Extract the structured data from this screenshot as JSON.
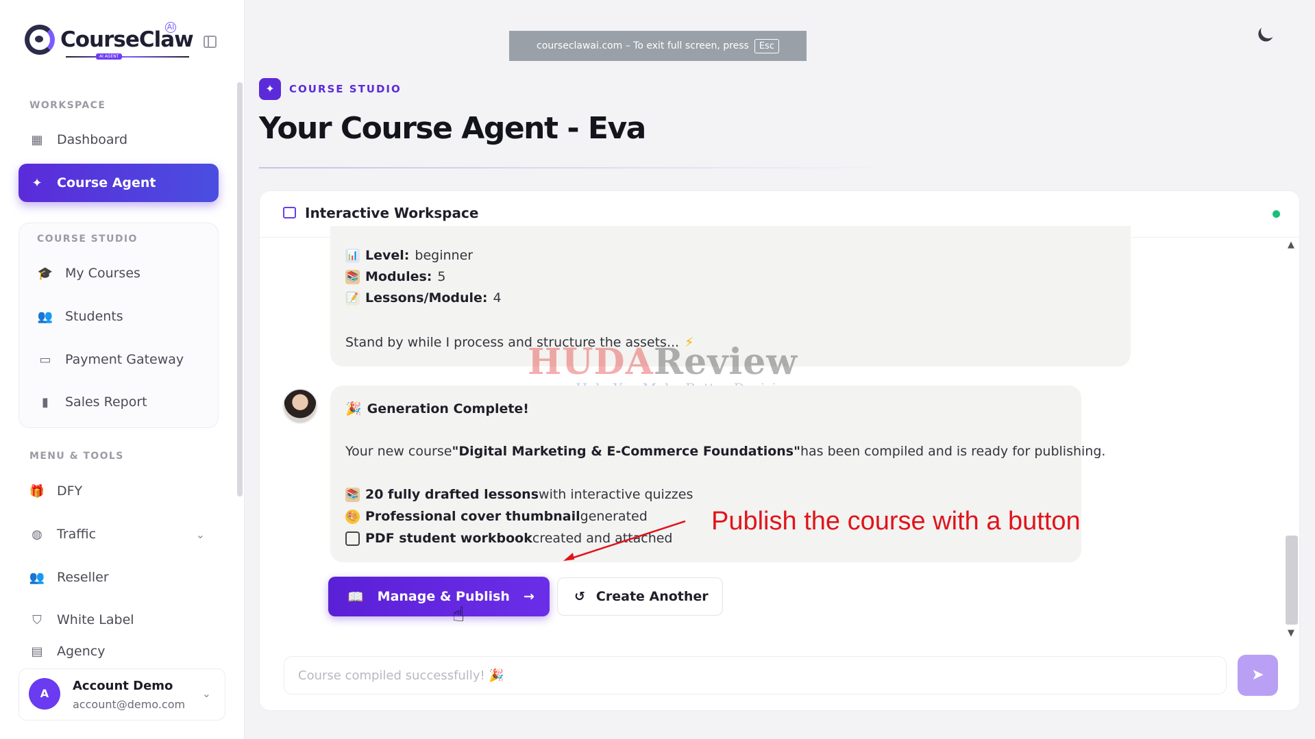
{
  "brand": {
    "name": "CourseClaw",
    "ai_badge": "AI",
    "tag": "AI AGENT"
  },
  "fullscreen_banner": {
    "text": "courseclawai.com – To exit full screen, press",
    "key": "Esc"
  },
  "sidebar": {
    "workspace_label": "WORKSPACE",
    "dashboard": "Dashboard",
    "course_agent": "Course Agent",
    "course_studio_label": "COURSE STUDIO",
    "studio_items": [
      "My Courses",
      "Students",
      "Payment Gateway",
      "Sales Report"
    ],
    "menu_label": "MENU & TOOLS",
    "menu_items": [
      "DFY",
      "Traffic",
      "Reseller",
      "White Label",
      "Agency"
    ]
  },
  "account": {
    "initial": "A",
    "name": "Account Demo",
    "email": "account@demo.com"
  },
  "header": {
    "section_tag": "COURSE STUDIO",
    "title": "Your Course Agent - Eva"
  },
  "workspace": {
    "title": "Interactive Workspace",
    "status_color": "#18c07a"
  },
  "message1": {
    "level_label": "Level:",
    "level_value": "beginner",
    "modules_label": "Modules:",
    "modules_value": "5",
    "lessons_label": "Lessons/Module:",
    "lessons_value": "4",
    "standby": "Stand by while I process and structure the assets..."
  },
  "message2": {
    "heading": "Generation Complete!",
    "intro_pre": "Your new course ",
    "course_name": "\"Digital Marketing & E-Commerce Foundations\"",
    "intro_post": " has been compiled and is ready for publishing.",
    "b1_bold": "20 fully drafted lessons",
    "b1_rest": " with interactive quizzes",
    "b2_bold": "Professional cover thumbnail",
    "b2_rest": " generated",
    "b3_bold": "PDF student workbook",
    "b3_rest": " created and attached"
  },
  "actions": {
    "publish": "Manage & Publish",
    "create_another": "Create Another"
  },
  "annotation": "Publish the course with a button",
  "watermark": {
    "part1": "HUDA",
    "part2": "Review",
    "sub": "Help You Make Better Decisions"
  },
  "input": {
    "placeholder": "Course compiled successfully! 🎉"
  },
  "colors": {
    "accent": "#5b2bd9",
    "status": "#18c07a",
    "annotation": "#e0141c"
  }
}
